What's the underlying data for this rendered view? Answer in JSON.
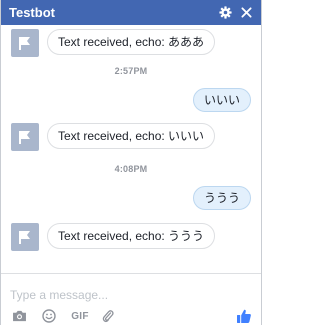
{
  "header": {
    "title": "Testbot",
    "settings_icon": "gear-icon",
    "close_icon": "close-icon",
    "color": "#4267b2"
  },
  "messages": [
    {
      "from": "bot",
      "text": "Text received, echo: あああ"
    },
    {
      "timestamp": "2:57PM"
    },
    {
      "from": "user",
      "text": "いいい"
    },
    {
      "from": "bot",
      "text": "Text received, echo: いいい"
    },
    {
      "timestamp": "4:08PM"
    },
    {
      "from": "user",
      "text": "ううう"
    },
    {
      "from": "bot",
      "text": "Text received, echo: ううう"
    }
  ],
  "composer": {
    "placeholder": "Type a message...",
    "tools": [
      "camera-icon",
      "emoji-icon",
      "gif-button",
      "paperclip-icon"
    ],
    "gif_label": "GIF",
    "like_icon": "thumbs-up-icon"
  }
}
